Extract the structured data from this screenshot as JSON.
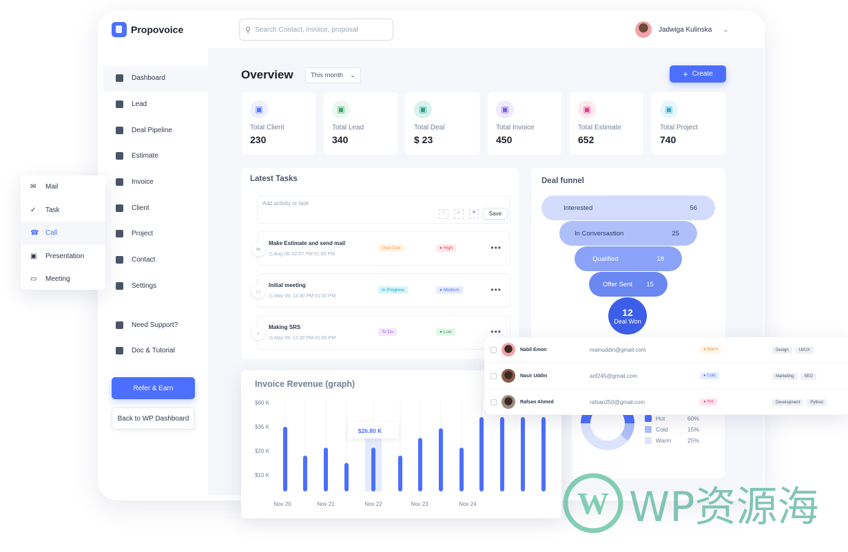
{
  "brand": {
    "name": "Propovoice",
    "accent": "#4c6fff"
  },
  "header": {
    "search_placeholder": "Search Contact, invoice, proposal",
    "user_name": "Jadwiga Kulinska"
  },
  "sidebar": {
    "items": [
      {
        "label": "Dashboard",
        "icon": "layers-icon",
        "active": true
      },
      {
        "label": "Lead",
        "icon": "users-icon"
      },
      {
        "label": "Deal Pipeline",
        "icon": "pipeline-icon"
      },
      {
        "label": "Estimate",
        "icon": "clipboard-icon"
      },
      {
        "label": "Invoice",
        "icon": "invoice-icon"
      },
      {
        "label": "Client",
        "icon": "client-icon"
      },
      {
        "label": "Project",
        "icon": "folder-icon"
      },
      {
        "label": "Contact",
        "icon": "contact-icon"
      },
      {
        "label": "Settings",
        "icon": "gear-icon"
      }
    ],
    "support": [
      {
        "label": "Need Support?",
        "icon": "layers-icon"
      },
      {
        "label": "Doc & Tutorial",
        "icon": "users-icon"
      }
    ],
    "refer_label": "Refer & Earn",
    "back_label": "Back to WP Dashboard"
  },
  "popup_menu": [
    {
      "label": "Mail",
      "icon": "mail-icon"
    },
    {
      "label": "Task",
      "icon": "check-circle-icon"
    },
    {
      "label": "Call",
      "icon": "phone-icon",
      "active": true
    },
    {
      "label": "Presentation",
      "icon": "presentation-icon"
    },
    {
      "label": "Meeting",
      "icon": "video-icon"
    }
  ],
  "overview": {
    "title": "Overview",
    "period": "This month",
    "create_label": "Create"
  },
  "stats": [
    {
      "label": "Total Client",
      "value": "230",
      "icon": "contact-book-icon",
      "bg": "#eef0ff",
      "fg": "#4c6fff"
    },
    {
      "label": "Total Lead",
      "value": "340",
      "icon": "users-icon",
      "bg": "#e9f8ee",
      "fg": "#38a169"
    },
    {
      "label": "Total Deal",
      "value": "$ 23",
      "icon": "handshake-icon",
      "bg": "#d8f3ee",
      "fg": "#2c9f8a"
    },
    {
      "label": "Total Invoice",
      "value": "450",
      "icon": "invoice-icon",
      "bg": "#efeaff",
      "fg": "#805ad5"
    },
    {
      "label": "Total Estimate",
      "value": "652",
      "icon": "estimate-icon",
      "bg": "#fde8ee",
      "fg": "#d53f8c"
    },
    {
      "label": "Total Project",
      "value": "740",
      "icon": "folder-icon",
      "bg": "#e6f7fb",
      "fg": "#3aa6c6"
    }
  ],
  "tasks": {
    "title": "Latest Tasks",
    "input_placeholder": "Add activity or task",
    "save_label": "Save",
    "items": [
      {
        "title": "Make Estimate and send mail",
        "time": "Aug 08, 02:07 PM-01:00 PM",
        "status": "Over Due",
        "status_bg": "#fff4e6",
        "status_fg": "#f6993f",
        "priority": "High",
        "pri_bg": "#ffe8ec",
        "pri_fg": "#e53e5e",
        "icon": "mail-icon"
      },
      {
        "title": "Initial meeting",
        "time": "May 09, 12:30 PM-01:00 PM",
        "status": "In Progress",
        "status_bg": "#d7f6fb",
        "status_fg": "#17a2b8",
        "priority": "Medium",
        "pri_bg": "#e8ecff",
        "pri_fg": "#4c6fff",
        "icon": "video-icon"
      },
      {
        "title": "Making SRS",
        "time": "May 09, 12:30 PM-01:00 PM",
        "status": "To Do",
        "status_bg": "#f3e8ff",
        "status_fg": "#a855f7",
        "priority": "Low",
        "pri_bg": "#e3f8e8",
        "pri_fg": "#38a169",
        "icon": "check-circle-icon"
      }
    ]
  },
  "funnel": {
    "title": "Deal funnel",
    "stages": [
      {
        "label": "Interested",
        "value": "56",
        "bg": "#d3dcfc",
        "fg": "#2d3a66"
      },
      {
        "label": "In Conversastion",
        "value": "25",
        "bg": "#aebffa",
        "fg": "#2d3a66"
      },
      {
        "label": "Qualified",
        "value": "18",
        "bg": "#8aa2f7",
        "fg": "#ffffff"
      },
      {
        "label": "Offer Sent",
        "value": "15",
        "bg": "#6b87f2",
        "fg": "#ffffff"
      }
    ],
    "won": {
      "value": "12",
      "label": "Deal Won",
      "bg": "#3d5ee8"
    }
  },
  "contacts": [
    {
      "name": "Nabil Emon",
      "email": "mainuddin@gmail.com",
      "status": "Warm",
      "status_bg": "#fff4e6",
      "status_fg": "#f6993f",
      "tags": [
        "Design",
        "UI/UX"
      ]
    },
    {
      "name": "Nasir Uddin",
      "email": "arif245@gmail.com",
      "status": "Cold",
      "status_bg": "#e8ecff",
      "status_fg": "#4c6fff",
      "tags": [
        "Marketing",
        "SEO"
      ]
    },
    {
      "name": "Rafsan Ahmed",
      "email": "rafsan250@gmail.com",
      "status": "Hot",
      "status_bg": "#ffe4ee",
      "status_fg": "#e53e7e",
      "tags": [
        "Development",
        "Python"
      ]
    }
  ],
  "lead_donut": {
    "legend": [
      {
        "label": "Hot",
        "value": "60%",
        "color": "#4c6fff"
      },
      {
        "label": "Cold",
        "value": "15%",
        "color": "#aebffa"
      },
      {
        "label": "Warm",
        "value": "25%",
        "color": "#dbe3fd"
      }
    ]
  },
  "chart_data": {
    "type": "bar",
    "title": "Invoice Revenue (graph)",
    "y_ticks": [
      "$60 K",
      "$35 K",
      "$20 K",
      "$10 K"
    ],
    "x_ticks": [
      "Nov 20",
      "Nov 21",
      "Nov 22",
      "Nov 23",
      "Nov 24"
    ],
    "values": [
      35,
      18,
      22,
      15,
      22,
      18,
      28,
      34,
      22,
      45,
      45,
      45,
      45
    ],
    "tooltip": "$26.80 K",
    "highlight_index": 4,
    "bar_color": "#4c6fff"
  },
  "watermark": {
    "text": "WP资源海"
  }
}
